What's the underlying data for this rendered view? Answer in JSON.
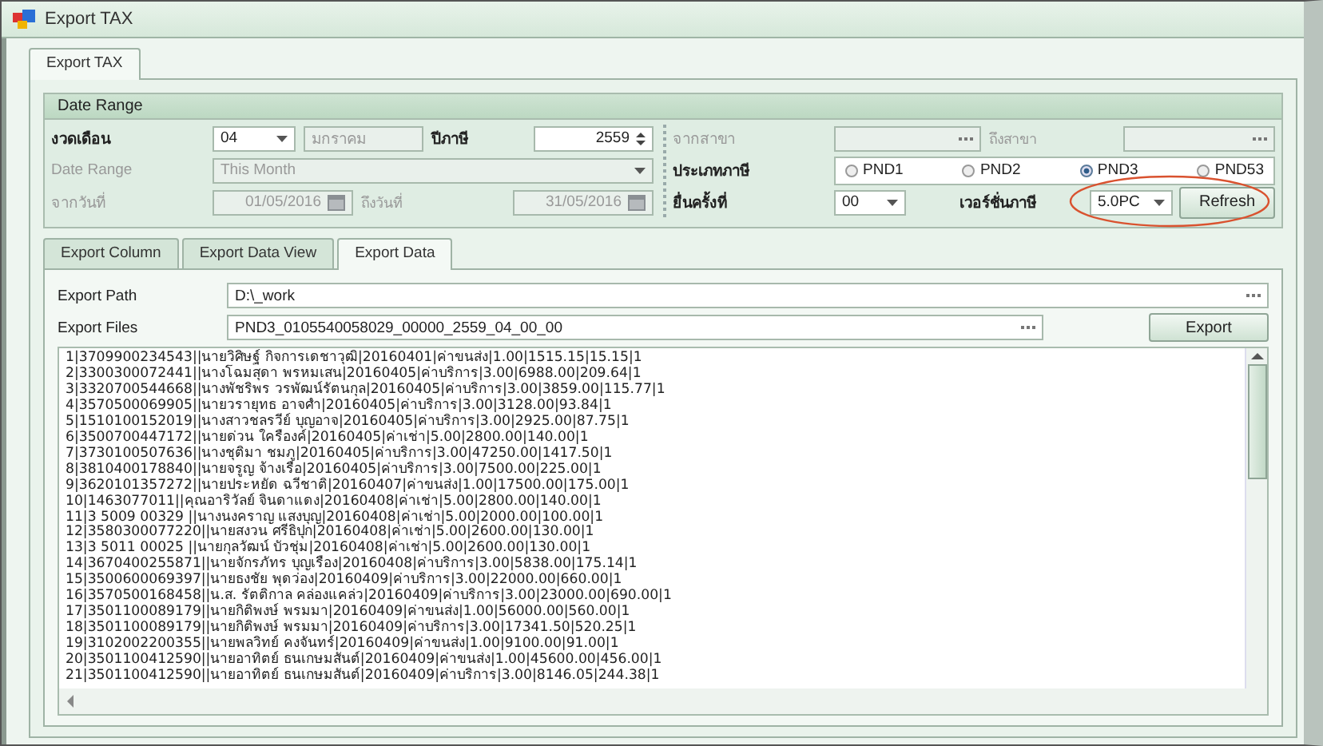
{
  "window": {
    "title": "Export TAX"
  },
  "main_tabs": [
    {
      "label": "Export TAX",
      "selected": true
    }
  ],
  "date_range": {
    "title": "Date Range",
    "period": {
      "label": "งวดเดือน",
      "disabled": false,
      "month": "04",
      "month_name": "มกราคม"
    },
    "tax_year": {
      "label": "ปีภาษี",
      "disabled": false,
      "value": "2559"
    },
    "range": {
      "label": "Date Range",
      "disabled": true,
      "value": "This Month"
    },
    "from_date": {
      "label": "จากวันที่",
      "disabled": true,
      "value": "01/05/2016"
    },
    "to_date": {
      "label": "ถึงวันที่",
      "disabled": true,
      "value": "31/05/2016"
    },
    "from_branch": {
      "label": "จากสาขา",
      "disabled": true
    },
    "to_branch": {
      "label": "ถึงสาขา",
      "disabled": true
    },
    "tax_type": {
      "label": "ประเภทภาษี",
      "disabled": false,
      "options": [
        {
          "label": "PND1",
          "selected": false
        },
        {
          "label": "PND2",
          "selected": false
        },
        {
          "label": "PND3",
          "selected": true
        },
        {
          "label": "PND53",
          "selected": false
        }
      ]
    },
    "filing_no": {
      "label": "ยื่นครั้งที่",
      "disabled": false,
      "value": "00"
    },
    "tax_version": {
      "label": "เวอร์ชั่นภาษี",
      "disabled": false,
      "value": "5.0PC"
    },
    "refresh_button": "Refresh"
  },
  "sub_tabs": [
    {
      "label": "Export Column",
      "selected": false
    },
    {
      "label": "Export Data View",
      "selected": false
    },
    {
      "label": "Export Data",
      "selected": true
    }
  ],
  "export_path": {
    "label": "Export Path",
    "value": "D:\\_work"
  },
  "export_files": {
    "label": "Export Files",
    "value": "PND3_0105540058029_00000_2559_04_00_00"
  },
  "export_button": "Export",
  "output_lines": [
    "1|3709900234543||นายวิศิษฐ์ กิจการเดชาวุฒิ|20160401|ค่าขนส่ง|1.00|1515.15|15.15|1",
    "2|3300300072441||นางโฉมสุดา พรหมเสน|20160405|ค่าบริการ|3.00|6988.00|209.64|1",
    "3|3320700544668||นางพัชริพร วรพัฒน์รัตนกุล|20160405|ค่าบริการ|3.00|3859.00|115.77|1",
    "4|3570500069905||นายวรายุทธ อาจศำ|20160405|ค่าบริการ|3.00|3128.00|93.84|1",
    "5|1510100152019||นางสาวชลรวีย์ บุญอาจ|20160405|ค่าบริการ|3.00|2925.00|87.75|1",
    "6|3500700447172||นายด่วน ใครืองค์|20160405|ค่าเช่า|5.00|2800.00|140.00|1",
    "7|3730100507636||นางชุติมา ชมภู|20160405|ค่าบริการ|3.00|47250.00|1417.50|1",
    "8|3810400178840||นายจรูญ จ้างเรือ|20160405|ค่าบริการ|3.00|7500.00|225.00|1",
    "9|3620101357272||นายประหยัด ฉวีชาติ|20160407|ค่าขนส่ง|1.00|17500.00|175.00|1",
    "10|1463077011||คุณอาริวัลย์ จินดาแดง|20160408|ค่าเช่า|5.00|2800.00|140.00|1",
    "11|3 5009 00329 ||นางนงคราญ แสงบุญ|20160408|ค่าเช่า|5.00|2000.00|100.00|1",
    "12|3580300077220||นายสงวน ศรีธิปุก|20160408|ค่าเช่า|5.00|2600.00|130.00|1",
    "13|3 5011 00025 ||นายกุลวัฒน์ บัวชุ่ม|20160408|ค่าเช่า|5.00|2600.00|130.00|1",
    "14|3670400255871||นายจักรภัทร บุญเรือง|20160408|ค่าบริการ|3.00|5838.00|175.14|1",
    "15|3500600069397||นายธงชัย พุดว่อง|20160409|ค่าบริการ|3.00|22000.00|660.00|1",
    "16|3570500168458||น.ส. รัตติกาล คล่องแคล่ว|20160409|ค่าบริการ|3.00|23000.00|690.00|1",
    "17|3501100089179||นายกิติพงษ์ พรมมา|20160409|ค่าขนส่ง|1.00|56000.00|560.00|1",
    "18|3501100089179||นายกิติพงษ์ พรมมา|20160409|ค่าบริการ|3.00|17341.50|520.25|1",
    "19|3102002200355||นายพลวิทย์ คงจันทร์|20160409|ค่าขนส่ง|1.00|9100.00|91.00|1",
    "20|3501100412590||นายอาทิตย์ ธนเกษมสันต์|20160409|ค่าขนส่ง|1.00|45600.00|456.00|1",
    "21|3501100412590||นายอาทิตย์ ธนเกษมสันต์|20160409|ค่าบริการ|3.00|8146.05|244.38|1"
  ]
}
